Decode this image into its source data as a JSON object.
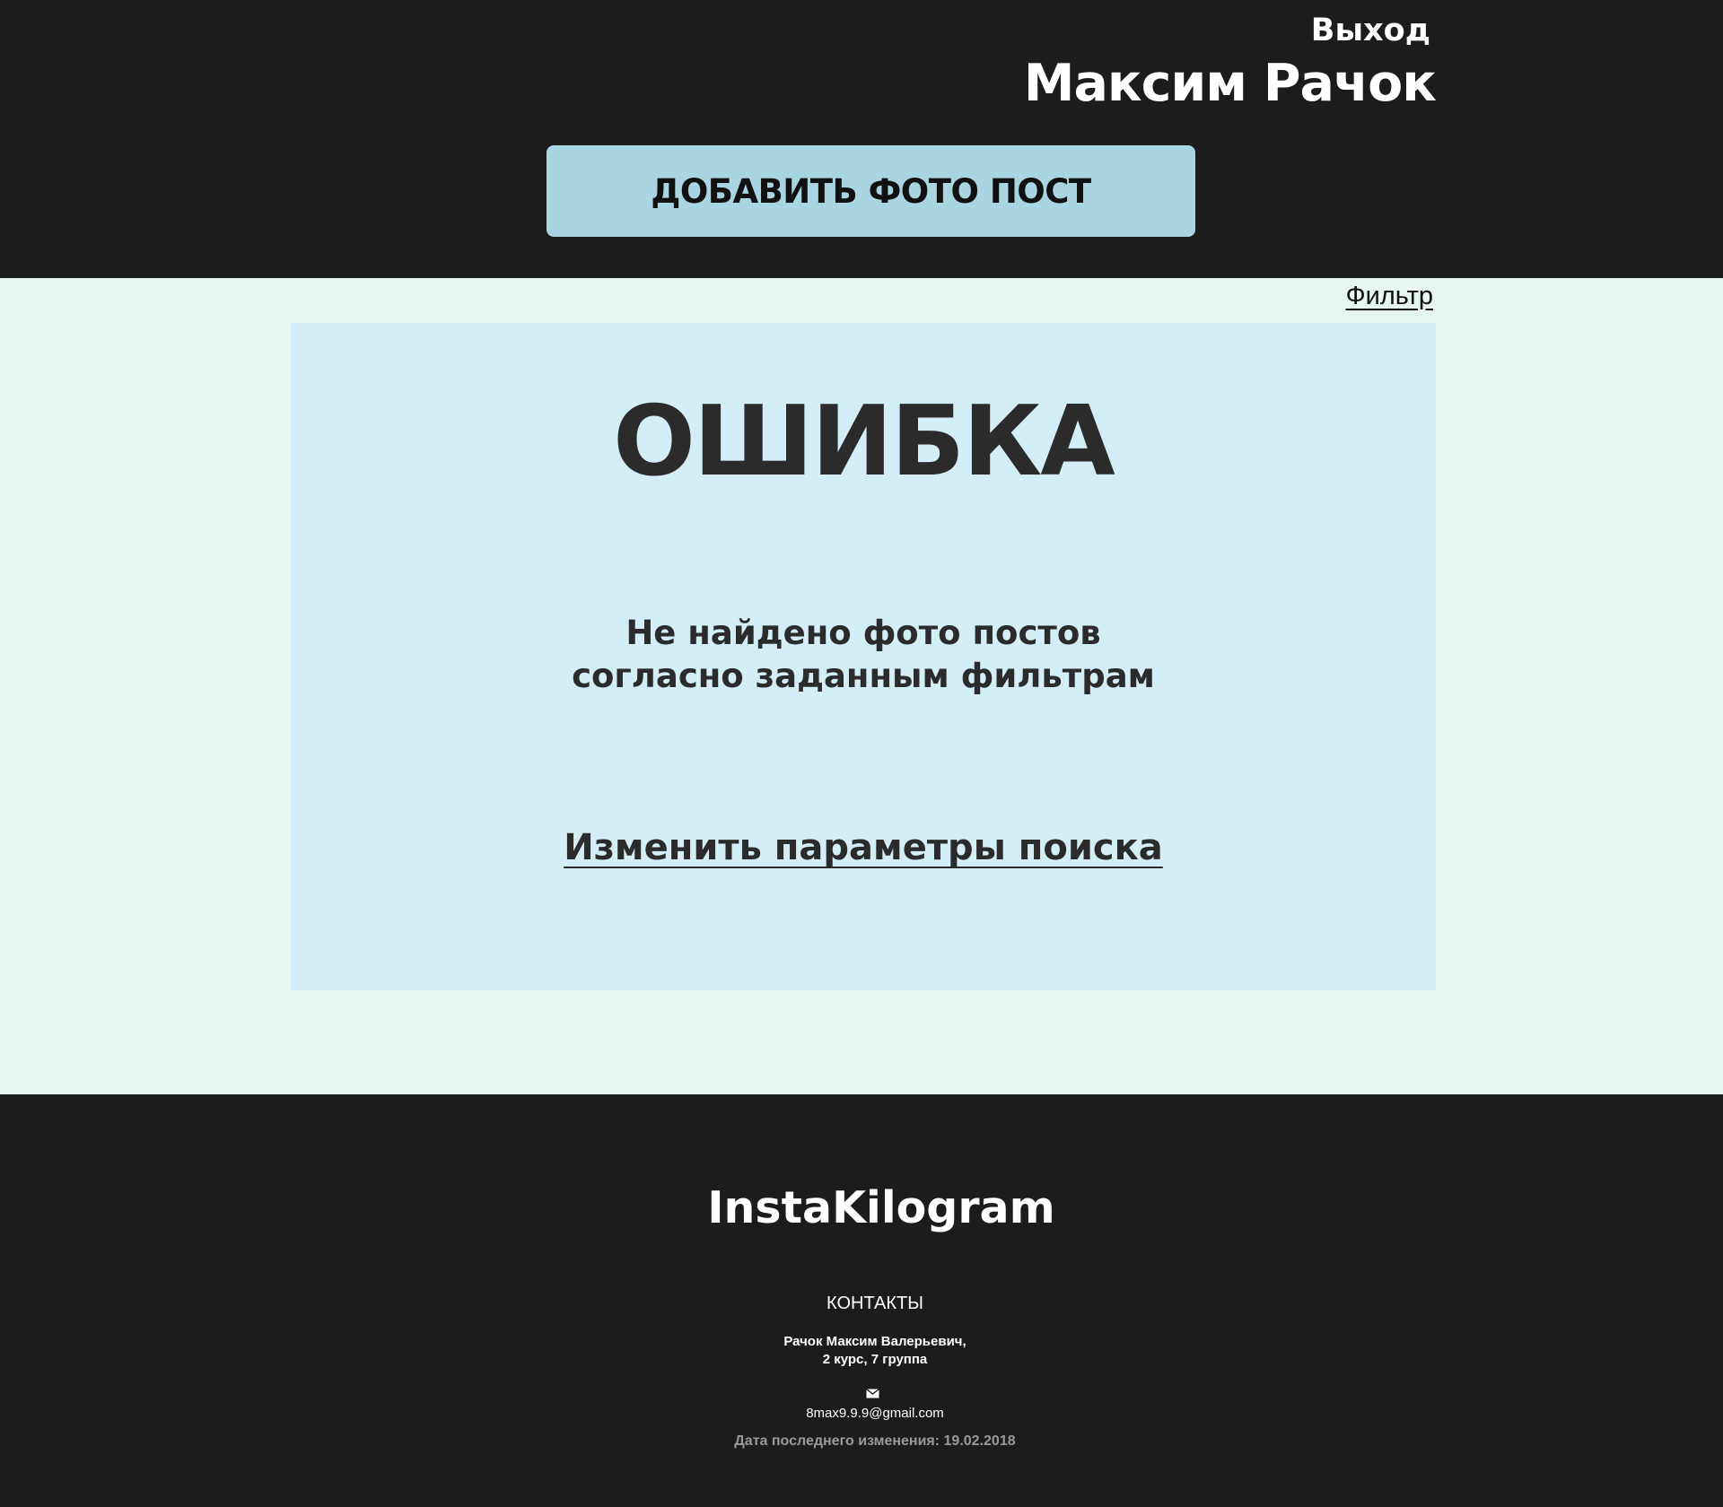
{
  "header": {
    "logout_label": "Выход",
    "username": "Максим Рачок",
    "add_post_label": "ДОБАВИТЬ ФОТО ПОСТ"
  },
  "main": {
    "filter_label": "Фильтр",
    "error": {
      "title": "ОШИБКА",
      "message_lines": [
        "Не найдено фото постов",
        "согласно заданным фильтрам"
      ],
      "change_search_label": "Изменить параметры поиска"
    }
  },
  "footer": {
    "brand": "InstaKilogram",
    "contacts_heading": "КОНТАКТЫ",
    "person_lines": [
      "Рачок Максим Валерьевич,",
      "2 курс, 7 группа"
    ],
    "mail_icon": "envelope-icon",
    "email": "8max9.9.9@gmail.com",
    "last_modified": "Дата последнего изменения: 19.02.2018"
  },
  "colors": {
    "dark_background": "#1c1c1c",
    "main_background": "#e6f6ef",
    "card_background": "#d4eef7",
    "button_background": "#a9d4e2",
    "text_dark": "#2b2b2b"
  }
}
